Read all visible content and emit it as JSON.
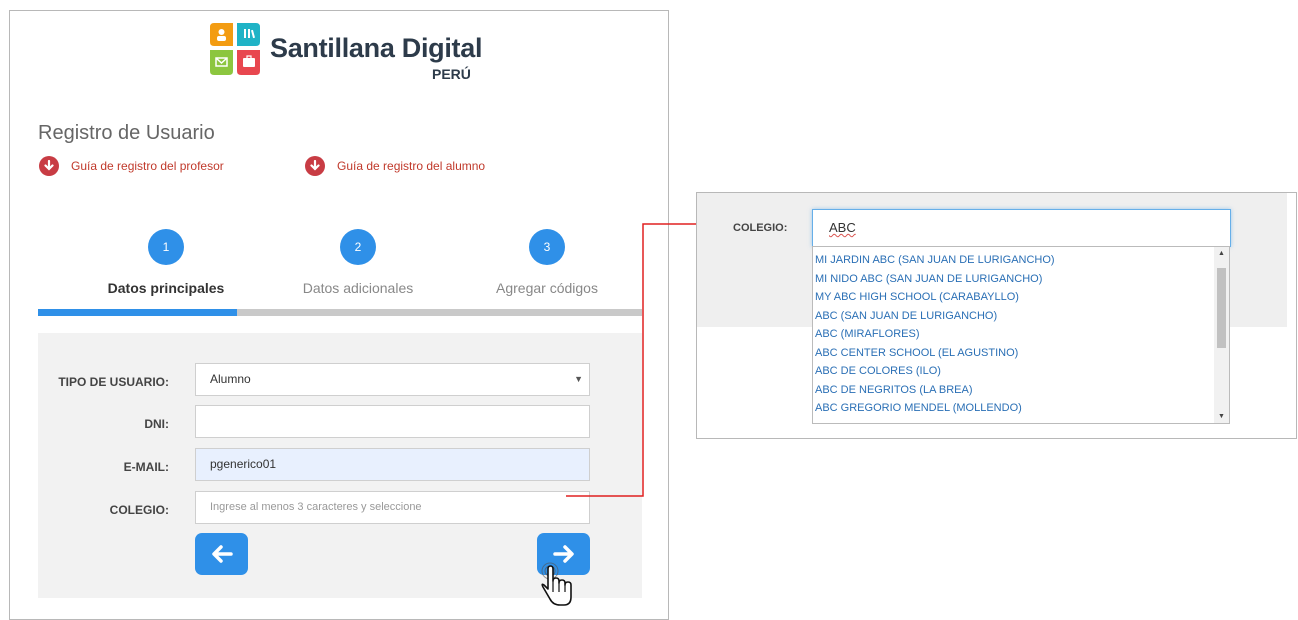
{
  "brand": {
    "title": "Santillana Digital",
    "subtitle": "PERÚ"
  },
  "page": {
    "title": "Registro de Usuario"
  },
  "guides": [
    {
      "label": "Guía de registro del profesor"
    },
    {
      "label": "Guía de registro del alumno"
    }
  ],
  "steps": [
    {
      "number": "1",
      "label": "Datos principales",
      "active": true
    },
    {
      "number": "2",
      "label": "Datos adicionales",
      "active": false
    },
    {
      "number": "3",
      "label": "Agregar códigos",
      "active": false
    }
  ],
  "progress": {
    "fraction": 0.33
  },
  "form": {
    "tipo_label": "TIPO DE USUARIO:",
    "tipo_value": "Alumno",
    "dni_label": "DNI:",
    "dni_value": "",
    "email_label": "E-MAIL:",
    "email_value": "pgenerico01",
    "colegio_label": "COLEGIO:",
    "colegio_placeholder": "Ingrese al menos 3 caracteres y seleccione"
  },
  "zoom": {
    "colegio_label": "COLEGIO:",
    "colegio_value": "ABC",
    "options": [
      "MI JARDIN ABC (SAN JUAN DE LURIGANCHO)",
      "MI NIDO ABC (SAN JUAN DE LURIGANCHO)",
      "MY ABC HIGH SCHOOL (CARABAYLLO)",
      "ABC (SAN JUAN DE LURIGANCHO)",
      "ABC (MIRAFLORES)",
      "ABC CENTER SCHOOL (EL AGUSTINO)",
      "ABC DE COLORES (ILO)",
      "ABC DE NEGRITOS (LA BREA)",
      "ABC GREGORIO MENDEL (MOLLENDO)"
    ]
  },
  "colors": {
    "accent": "#2f90e8",
    "guide_red": "#c83c44",
    "connector_red": "#e02020",
    "link_blue": "#2a6fb5"
  }
}
